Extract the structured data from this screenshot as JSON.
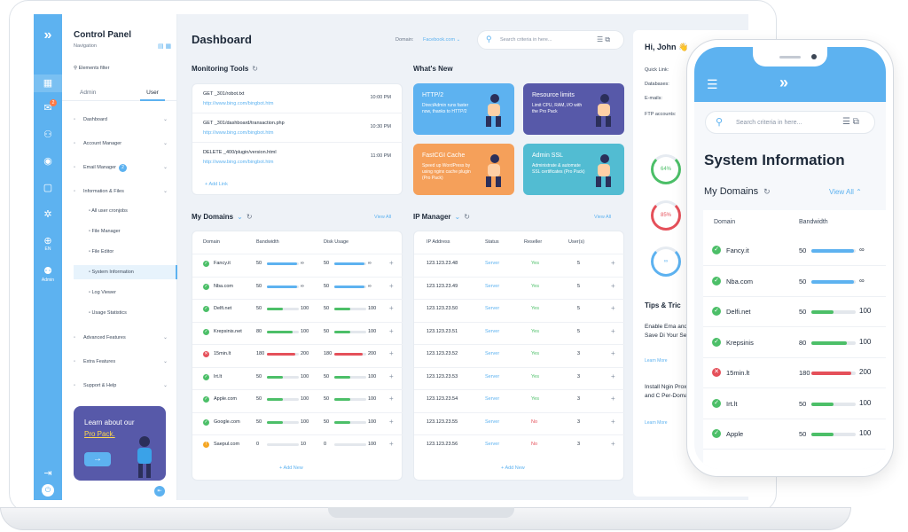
{
  "colors": {
    "accent": "#5db2f0",
    "success": "#4cbf68",
    "danger": "#e5505a",
    "warning": "#f5a623",
    "promo": "#5759a9"
  },
  "sidebar": {
    "title": "Control Panel",
    "subtitle": "Navigation",
    "filter": "Elements filter",
    "tabs": [
      "Admin",
      "User"
    ],
    "rail_lang": "EN",
    "rail_admin": "Admin",
    "rail_badge": "2",
    "items": [
      {
        "label": "Dashboard",
        "icon": "grid-icon"
      },
      {
        "label": "Account Manager",
        "icon": "user-icon"
      },
      {
        "label": "Email Manager",
        "icon": "mail-icon",
        "count": "2"
      },
      {
        "label": "Information & Files",
        "icon": "folder-icon"
      }
    ],
    "subitems": [
      {
        "label": "All user cronjobs",
        "icon": "clock-icon"
      },
      {
        "label": "File Manager",
        "icon": "folder-icon"
      },
      {
        "label": "File Editor",
        "icon": "edit-icon"
      },
      {
        "label": "System Information",
        "icon": "server-icon"
      },
      {
        "label": "Log Viewer",
        "icon": "doc-icon"
      },
      {
        "label": "Usage Statistics",
        "icon": "chart-icon"
      }
    ],
    "bottom_items": [
      {
        "label": "Advanced Features",
        "icon": "layers-icon"
      },
      {
        "label": "Extra Features",
        "icon": "plus-box-icon"
      },
      {
        "label": "Support & Help",
        "icon": "help-icon"
      }
    ],
    "promo": {
      "line1": "Learn about our",
      "line2": "Pro Pack."
    }
  },
  "header": {
    "title": "Dashboard",
    "domain_label": "Domain:",
    "domain_value": "Facebook.com",
    "search_placeholder": "Search criteria in here..."
  },
  "monitoring": {
    "title": "Monitoring Tools",
    "rows": [
      {
        "path": "GET _301/robot.txt",
        "url": "http://www.bing.com/bingbot.htm",
        "time": "10:00 PM"
      },
      {
        "path": "GET _301/dashboard/transaction.php",
        "url": "http://www.bing.com/bingbot.htm",
        "time": "10:30 PM"
      },
      {
        "path": "DELETE _400/plugin/version.html",
        "url": "http://www.bing.com/bingbot.htm",
        "time": "11:00 PM"
      }
    ],
    "add_link": "Add Link"
  },
  "whats_new": {
    "title": "What's New",
    "cards": [
      {
        "title": "HTTP/2",
        "desc": "DirectAdmin runs faster now, thanks to HTTP/2",
        "color": "#5db2f0"
      },
      {
        "title": "Resource limits",
        "desc": "Limit CPU, RAM, I/O with the Pro Pack",
        "color": "#5759a9"
      },
      {
        "title": "FastCGI Cache",
        "desc": "Speed up WordPress by using nginx cache plugin (Pro Pack)",
        "color": "#f5a05a"
      },
      {
        "title": "Admin SSL",
        "desc": "Administrate & automate SSL certificates (Pro Pack)",
        "color": "#52bcd2"
      }
    ]
  },
  "domains": {
    "title": "My Domains",
    "view_all": "View All",
    "columns": [
      "Domain",
      "Bandwidth",
      "Disk Usage"
    ],
    "add_new": "Add New",
    "rows": [
      {
        "name": "Fancy.it",
        "status": "ok",
        "bw": "50",
        "bw_fill": 0.95,
        "bw_end": "∞",
        "disk": "50",
        "disk_fill": 0.95,
        "disk_end": "∞"
      },
      {
        "name": "Nba.com",
        "status": "ok",
        "bw": "50",
        "bw_fill": 0.95,
        "bw_end": "∞",
        "disk": "50",
        "disk_fill": 0.95,
        "disk_end": "∞"
      },
      {
        "name": "Delfi.net",
        "status": "ok",
        "bw": "50",
        "bw_fill": 0.5,
        "bw_end": "100",
        "disk": "50",
        "disk_fill": 0.5,
        "disk_end": "100"
      },
      {
        "name": "Krepsinis.net",
        "status": "ok",
        "bw": "80",
        "bw_fill": 0.8,
        "bw_end": "100",
        "disk": "50",
        "disk_fill": 0.5,
        "disk_end": "100"
      },
      {
        "name": "15min.lt",
        "status": "error",
        "bw": "180",
        "bw_fill": 0.9,
        "bw_end": "200",
        "disk": "180",
        "disk_fill": 0.9,
        "disk_end": "200"
      },
      {
        "name": "Irt.lt",
        "status": "ok",
        "bw": "50",
        "bw_fill": 0.5,
        "bw_end": "100",
        "disk": "50",
        "disk_fill": 0.5,
        "disk_end": "100"
      },
      {
        "name": "Apple.com",
        "status": "ok",
        "bw": "50",
        "bw_fill": 0.5,
        "bw_end": "100",
        "disk": "50",
        "disk_fill": 0.5,
        "disk_end": "100"
      },
      {
        "name": "Google.com",
        "status": "ok",
        "bw": "50",
        "bw_fill": 0.5,
        "bw_end": "100",
        "disk": "50",
        "disk_fill": 0.5,
        "disk_end": "100"
      },
      {
        "name": "Saepul.com",
        "status": "warn",
        "bw": "0",
        "bw_fill": 0,
        "bw_end": "10",
        "disk": "0",
        "disk_fill": 0,
        "disk_end": "100"
      }
    ]
  },
  "ip_manager": {
    "title": "IP Manager",
    "view_all": "View All",
    "columns": [
      "IP Address",
      "Status",
      "Reseller",
      "User(s)"
    ],
    "add_new": "Add New",
    "rows": [
      {
        "ip": "123.123.23.48",
        "status": "Server",
        "reseller": "Yes",
        "users": "5"
      },
      {
        "ip": "123.123.23.49",
        "status": "Server",
        "reseller": "Yes",
        "users": "5"
      },
      {
        "ip": "123.123.23.50",
        "status": "Server",
        "reseller": "Yes",
        "users": "5"
      },
      {
        "ip": "123.123.23.51",
        "status": "Server",
        "reseller": "Yes",
        "users": "5"
      },
      {
        "ip": "123.123.23.52",
        "status": "Server",
        "reseller": "Yes",
        "users": "3"
      },
      {
        "ip": "123.123.23.53",
        "status": "Server",
        "reseller": "Yes",
        "users": "3"
      },
      {
        "ip": "123.123.23.54",
        "status": "Server",
        "reseller": "Yes",
        "users": "3"
      },
      {
        "ip": "123.123.23.55",
        "status": "Server",
        "reseller": "No",
        "users": "3"
      },
      {
        "ip": "123.123.23.56",
        "status": "Server",
        "reseller": "No",
        "users": "3"
      }
    ]
  },
  "right_panel": {
    "greeting": "Hi, John 👋",
    "labels": [
      "Quick Link:",
      "Databases:",
      "E-mails:",
      "FTP accounts:"
    ],
    "gauges": [
      {
        "label": "64%",
        "color": "#4cbf68"
      },
      {
        "label": "85%",
        "color": "#e5505a"
      },
      {
        "label": "∞",
        "color": "#5db2f0"
      }
    ],
    "tips_title": "Tips & Tric",
    "tips": [
      {
        "text": "Enable Ema and Save Di Your Server",
        "more": "Learn More"
      },
      {
        "text": "Install Ngin Proxy and C Per-Domain",
        "more": "Learn More"
      }
    ]
  },
  "phone": {
    "search_placeholder": "Search criteria in here...",
    "title": "System Information",
    "my_domains": "My Domains",
    "view_all": "View All",
    "columns": [
      "Domain",
      "Bandwidth"
    ],
    "rows": [
      {
        "name": "Fancy.it",
        "status": "ok",
        "v": "50",
        "fill": 0.95,
        "end": "∞"
      },
      {
        "name": "Nba.com",
        "status": "ok",
        "v": "50",
        "fill": 0.95,
        "end": "∞"
      },
      {
        "name": "Delfi.net",
        "status": "ok",
        "v": "50",
        "fill": 0.5,
        "end": "100"
      },
      {
        "name": "Krepsinis",
        "status": "ok",
        "v": "80",
        "fill": 0.8,
        "end": "100"
      },
      {
        "name": "15min.lt",
        "status": "error",
        "v": "180",
        "fill": 0.9,
        "end": "200"
      },
      {
        "name": "Irt.lt",
        "status": "ok",
        "v": "50",
        "fill": 0.5,
        "end": "100"
      },
      {
        "name": "Apple",
        "status": "ok",
        "v": "50",
        "fill": 0.5,
        "end": "100"
      }
    ]
  }
}
